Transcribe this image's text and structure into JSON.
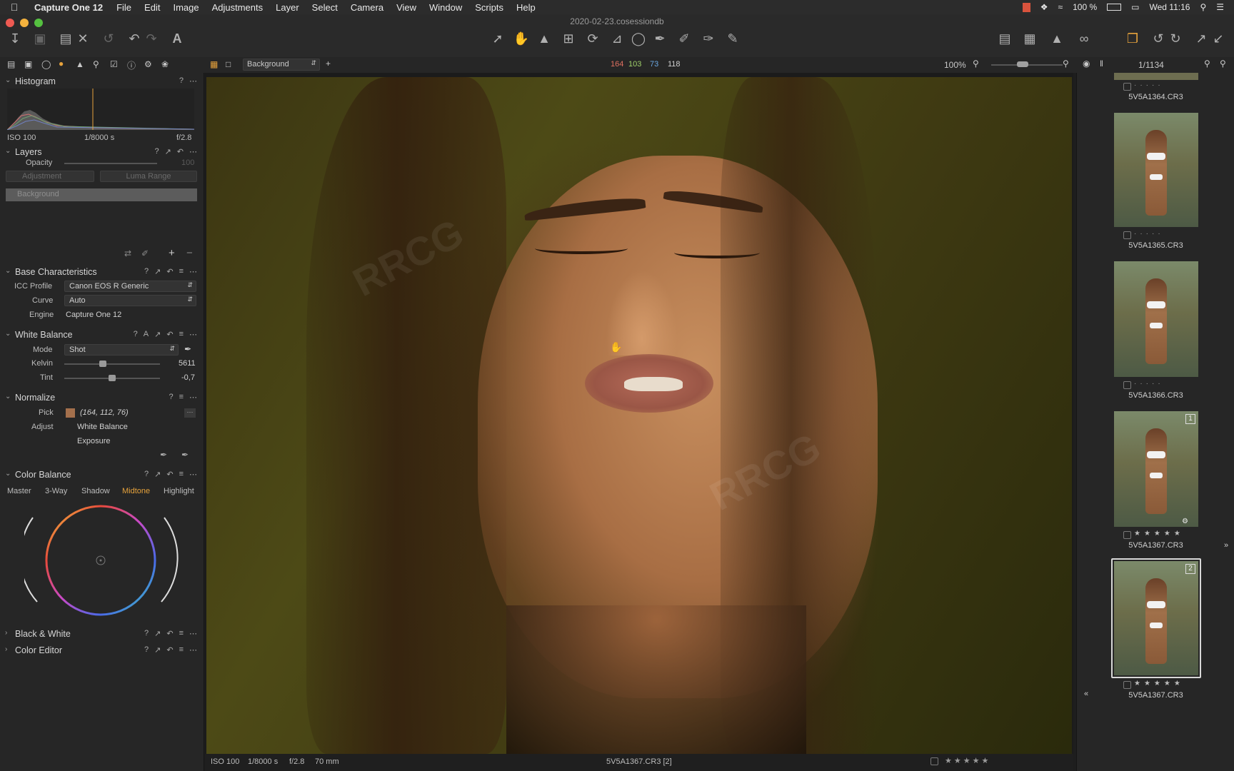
{
  "menubar": {
    "apple": "",
    "app_name": "Capture One 12",
    "items": [
      "File",
      "Edit",
      "Image",
      "Adjustments",
      "Layer",
      "Select",
      "Camera",
      "View",
      "Window",
      "Scripts",
      "Help"
    ],
    "battery": "100 %",
    "clock": "Wed 11:16"
  },
  "window": {
    "title": "2020-02-23.cosessiondb"
  },
  "subbar": {
    "layer_select": "Background",
    "rgb_r": "164",
    "rgb_g": "103",
    "rgb_b": "73",
    "luma": "118",
    "zoom": "100%",
    "counter": "1/1134"
  },
  "left": {
    "histogram": {
      "title": "Histogram",
      "iso": "ISO 100",
      "shutter": "1/8000 s",
      "aperture": "f/2.8"
    },
    "layers": {
      "title": "Layers",
      "opacity_label": "Opacity",
      "opacity_value": "100",
      "adjustment_label": "Adjustment",
      "luma_range_label": "Luma Range",
      "background_layer": "Background"
    },
    "base": {
      "title": "Base Characteristics",
      "icc_label": "ICC Profile",
      "icc_value": "Canon EOS R Generic",
      "curve_label": "Curve",
      "curve_value": "Auto",
      "engine_label": "Engine",
      "engine_value": "Capture One 12"
    },
    "wb": {
      "title": "White Balance",
      "mode_label": "Mode",
      "mode_value": "Shot",
      "kelvin_label": "Kelvin",
      "kelvin_value": "5611",
      "kelvin_level": 0.4,
      "tint_label": "Tint",
      "tint_value": "-0,7",
      "tint_level": 0.5
    },
    "normalize": {
      "title": "Normalize",
      "pick_label": "Pick",
      "pick_value": "(164, 112, 76)",
      "pick_color": "#a4704c",
      "adjust_label": "Adjust",
      "opt_wb": "White Balance",
      "opt_exposure": "Exposure"
    },
    "color_balance": {
      "title": "Color Balance",
      "tabs": [
        "Master",
        "3-Way",
        "Shadow",
        "Midtone",
        "Highlight"
      ],
      "active_tab": "Midtone"
    },
    "bw": {
      "title": "Black & White"
    },
    "color_editor": {
      "title": "Color Editor"
    }
  },
  "viewer": {
    "status": {
      "iso": "ISO 100",
      "shutter": "1/8000 s",
      "aperture": "f/2.8",
      "focal": "70 mm",
      "filename": "5V5A1367.CR3 [2]"
    }
  },
  "browser": {
    "items": [
      {
        "name": "5V5A1364.CR3",
        "badge": ""
      },
      {
        "name": "5V5A1365.CR3",
        "badge": ""
      },
      {
        "name": "5V5A1366.CR3",
        "badge": ""
      },
      {
        "name": "5V5A1367.CR3",
        "badge": "1"
      },
      {
        "name": "5V5A1367.CR3",
        "badge": "2"
      }
    ]
  },
  "colors": {
    "accent": "#e6a23c",
    "panel": "#262626",
    "background": "#1e1e1e"
  }
}
